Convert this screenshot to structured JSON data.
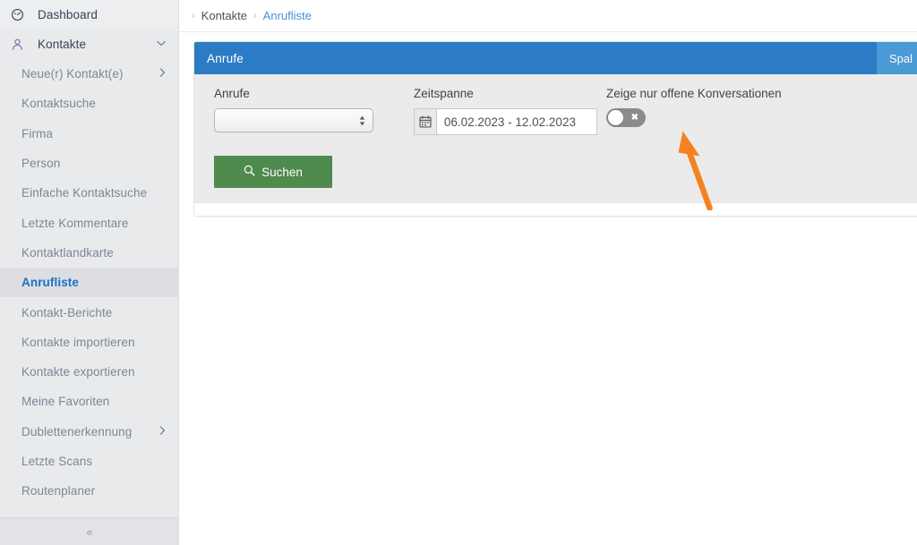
{
  "sidebar": {
    "items": [
      {
        "label": "Dashboard",
        "icon": "gauge-icon",
        "level": "top",
        "state": "hover",
        "caret": ""
      },
      {
        "label": "Kontakte",
        "icon": "person-icon",
        "level": "top",
        "state": "expanded",
        "caret": "⌄"
      },
      {
        "label": "Neue(r) Kontakt(e)",
        "icon": "",
        "level": "sub",
        "state": "",
        "caret": "›"
      },
      {
        "label": "Kontaktsuche",
        "icon": "",
        "level": "sub",
        "state": "",
        "caret": ""
      },
      {
        "label": "Firma",
        "icon": "",
        "level": "sub",
        "state": "",
        "caret": ""
      },
      {
        "label": "Person",
        "icon": "",
        "level": "sub",
        "state": "",
        "caret": ""
      },
      {
        "label": "Einfache Kontaktsuche",
        "icon": "",
        "level": "sub",
        "state": "",
        "caret": ""
      },
      {
        "label": "Letzte Kommentare",
        "icon": "",
        "level": "sub",
        "state": "",
        "caret": ""
      },
      {
        "label": "Kontaktlandkarte",
        "icon": "",
        "level": "sub",
        "state": "",
        "caret": ""
      },
      {
        "label": "Anrufliste",
        "icon": "",
        "level": "sub",
        "state": "active",
        "caret": ""
      },
      {
        "label": "Kontakt-Berichte",
        "icon": "",
        "level": "sub",
        "state": "",
        "caret": ""
      },
      {
        "label": "Kontakte importieren",
        "icon": "",
        "level": "sub",
        "state": "",
        "caret": ""
      },
      {
        "label": "Kontakte exportieren",
        "icon": "",
        "level": "sub",
        "state": "",
        "caret": ""
      },
      {
        "label": "Meine Favoriten",
        "icon": "",
        "level": "sub",
        "state": "",
        "caret": ""
      },
      {
        "label": "Dublettenerkennung",
        "icon": "",
        "level": "sub",
        "state": "",
        "caret": "›"
      },
      {
        "label": "Letzte Scans",
        "icon": "",
        "level": "sub",
        "state": "",
        "caret": ""
      },
      {
        "label": "Routenplaner",
        "icon": "",
        "level": "sub",
        "state": "",
        "caret": ""
      }
    ],
    "collapse_label": "«"
  },
  "breadcrumb": {
    "leading_chevron": "›",
    "separator": "›",
    "parent": "Kontakte",
    "current": "Anrufliste"
  },
  "panel": {
    "title": "Anrufe",
    "columns_button": "Spal",
    "header_color": "#2b7cc4",
    "columns_button_color": "#4a9ad6"
  },
  "form": {
    "anrufe": {
      "label": "Anrufe",
      "value": "",
      "options": [
        ""
      ]
    },
    "zeitspanne": {
      "label": "Zeitspanne",
      "value": "06.02.2023 - 12.02.2023",
      "placeholder": "06.02.2023 - 12.02.2023",
      "icon": "calendar-icon"
    },
    "toggle": {
      "label": "Zeige nur offene Konversationen",
      "state": "off",
      "mark": "✖"
    },
    "search_button": {
      "label": "Suchen",
      "icon": "search-icon",
      "color": "#4f8a4f"
    }
  },
  "annotation": {
    "type": "arrow",
    "color": "#f58220",
    "points_to": "zeitspanne-input"
  }
}
